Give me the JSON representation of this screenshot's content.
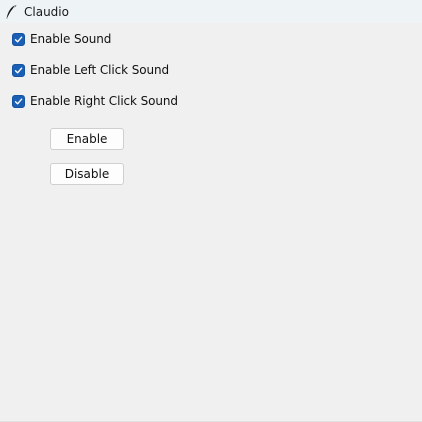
{
  "window": {
    "title": "Claudio",
    "icon": "feather-icon"
  },
  "options": [
    {
      "label": "Enable Sound",
      "checked": true
    },
    {
      "label": "Enable Left Click Sound",
      "checked": true
    },
    {
      "label": "Enable Right Click Sound",
      "checked": true
    }
  ],
  "buttons": {
    "enable_label": "Enable",
    "disable_label": "Disable"
  },
  "colors": {
    "checkbox_accent": "#1a5fb4",
    "background": "#f0f0f0",
    "titlebar": "#eef4f6"
  }
}
